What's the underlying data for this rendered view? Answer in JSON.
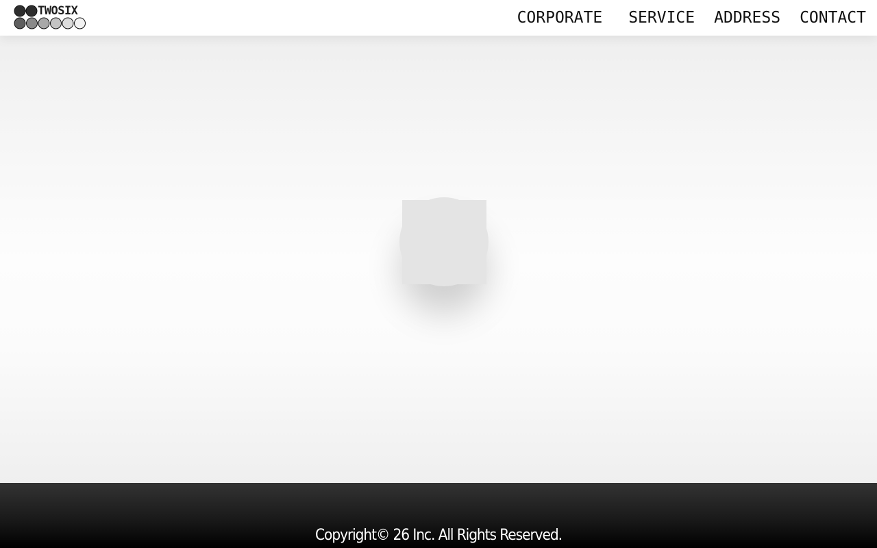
{
  "header": {
    "logo": {
      "text": "TWOSIX",
      "icon": "two-six-dots-logo",
      "dot_colors_top": [
        "#2e2e2e",
        "#2e2e2e"
      ],
      "dot_colors_bottom": [
        "#5f5f5f",
        "#8a8a8a",
        "#a8a8a8",
        "#c4c4c4",
        "#dcdcdc",
        "#f2f2f2"
      ]
    },
    "nav": [
      {
        "label": "CORPORATE"
      },
      {
        "label": "SERVICE"
      },
      {
        "label": "ADDRESS"
      },
      {
        "label": "CONTACT"
      }
    ]
  },
  "main": {
    "loader_icon": "loading-spinner-icon",
    "loader_color": "#e4e4e4"
  },
  "footer": {
    "copyright": "Copyright© 26 Inc. All Rights Reserved."
  },
  "colors": {
    "header_bg": "#ffffff",
    "footer_bg": "#1a1a1a",
    "footer_text": "#ffffff"
  }
}
